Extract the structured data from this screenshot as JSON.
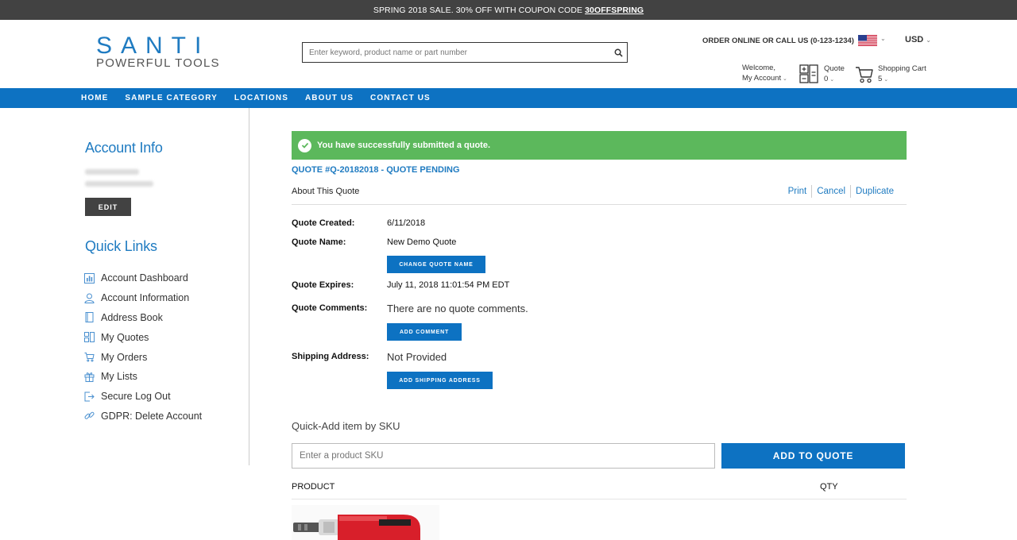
{
  "promo": {
    "text": "SPRING 2018 SALE. 30% OFF WITH COUPON CODE",
    "code": "30OFFSPRING"
  },
  "logo": {
    "brand": "SANTI",
    "tagline": "POWERFUL TOOLS"
  },
  "search": {
    "placeholder": "Enter keyword, product name or part number"
  },
  "header": {
    "order_online": "ORDER ONLINE OR CALL US (0-123-1234)",
    "currency": "USD",
    "welcome": "Welcome,",
    "my_account": "My Account",
    "quote_label": "Quote",
    "quote_count": "0",
    "cart_label": "Shopping Cart",
    "cart_count": "5"
  },
  "nav": [
    "HOME",
    "SAMPLE CATEGORY",
    "LOCATIONS",
    "ABOUT US",
    "CONTACT US"
  ],
  "sidebar": {
    "account_info_title": "Account Info",
    "edit_label": "EDIT",
    "quick_links_title": "Quick Links",
    "links": [
      {
        "label": "Account Dashboard",
        "icon": "dashboard-icon"
      },
      {
        "label": "Account Information",
        "icon": "user-icon"
      },
      {
        "label": "Address Book",
        "icon": "book-icon"
      },
      {
        "label": "My Quotes",
        "icon": "quotes-icon"
      },
      {
        "label": "My Orders",
        "icon": "cart-icon"
      },
      {
        "label": "My Lists",
        "icon": "gift-icon"
      },
      {
        "label": "Secure Log Out",
        "icon": "logout-icon"
      },
      {
        "label": "GDPR: Delete Account",
        "icon": "link-icon"
      }
    ]
  },
  "main": {
    "success_message": "You have successfully submitted a quote.",
    "quote_title": "QUOTE #Q-20182018 - QUOTE PENDING",
    "about_title": "About This Quote",
    "actions": {
      "print": "Print",
      "cancel": "Cancel",
      "duplicate": "Duplicate"
    },
    "details": {
      "created_label": "Quote Created:",
      "created_value": "6/11/2018",
      "name_label": "Quote Name:",
      "name_value": "New Demo Quote",
      "change_name_btn": "CHANGE QUOTE NAME",
      "expires_label": "Quote Expires:",
      "expires_value": "July 11, 2018 11:01:54 PM EDT",
      "comments_label": "Quote Comments:",
      "comments_value": "There are no quote comments.",
      "add_comment_btn": "ADD COMMENT",
      "shipping_label": "Shipping Address:",
      "shipping_value": "Not Provided",
      "add_shipping_btn": "ADD SHIPPING ADDRESS"
    },
    "quick_add": {
      "title": "Quick-Add item by SKU",
      "placeholder": "Enter a product SKU",
      "button": "ADD TO QUOTE"
    },
    "table": {
      "product_header": "PRODUCT",
      "qty_header": "QTY"
    }
  }
}
